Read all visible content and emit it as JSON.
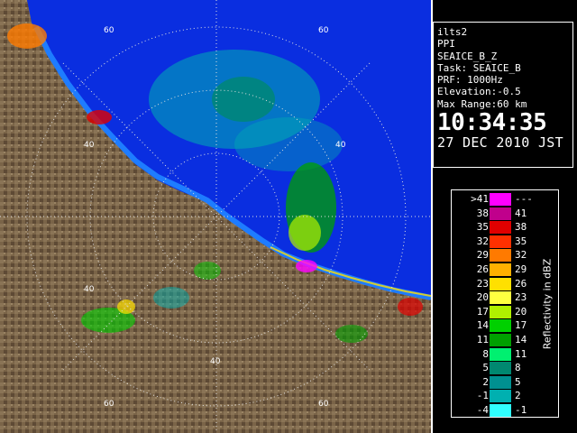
{
  "info": {
    "lines": [
      "ilts2",
      "PPI",
      "SEAICE_B_Z",
      "Task: SEAICE_B",
      "PRF: 1000Hz",
      "Elevation:-0.5",
      "Max Range:60 km"
    ],
    "time": "10:34:35",
    "date": "27 DEC 2010 JST"
  },
  "legend": {
    "unit": "Reflectivity in dBZ",
    "rows": [
      {
        "left": ">41",
        "right": "---",
        "color": "#ff00ff"
      },
      {
        "left": "38",
        "right": "41",
        "color": "#c0008c"
      },
      {
        "left": "35",
        "right": "38",
        "color": "#e00000"
      },
      {
        "left": "32",
        "right": "35",
        "color": "#ff3000"
      },
      {
        "left": "29",
        "right": "32",
        "color": "#ff7a00"
      },
      {
        "left": "26",
        "right": "29",
        "color": "#ffb000"
      },
      {
        "left": "23",
        "right": "26",
        "color": "#ffe000"
      },
      {
        "left": "20",
        "right": "23",
        "color": "#ffff40"
      },
      {
        "left": "17",
        "right": "20",
        "color": "#b0f000"
      },
      {
        "left": "14",
        "right": "17",
        "color": "#00d000"
      },
      {
        "left": "11",
        "right": "14",
        "color": "#00a000"
      },
      {
        "left": "8",
        "right": "11",
        "color": "#00f070"
      },
      {
        "left": "5",
        "right": "8",
        "color": "#008870"
      },
      {
        "left": "2",
        "right": "5",
        "color": "#009090"
      },
      {
        "left": "-1",
        "right": "2",
        "color": "#00b0b0"
      },
      {
        "left": "-4",
        "right": "-1",
        "color": "#30ffff"
      }
    ]
  },
  "range_labels": [
    "60",
    "60",
    "40",
    "40",
    "40",
    "40",
    "60",
    "60"
  ],
  "colors": {
    "land": "#7a6448",
    "sea": "#0a2ee0",
    "sea_clutter": "#1e7cff"
  }
}
